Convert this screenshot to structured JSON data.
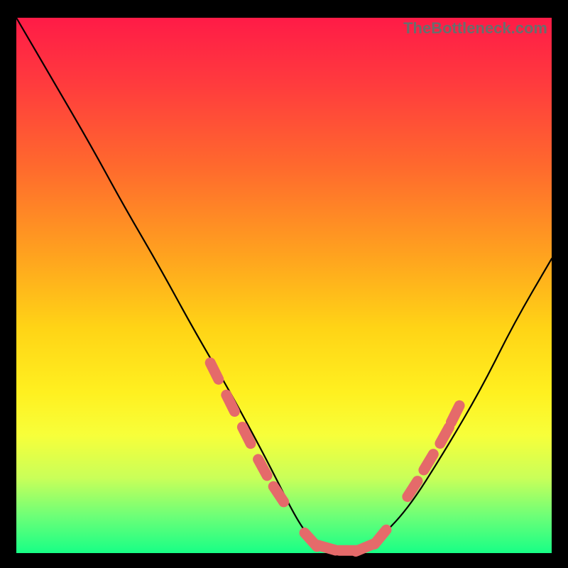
{
  "watermark": "TheBottleneck.com",
  "chart_data": {
    "type": "line",
    "title": "",
    "xlabel": "",
    "ylabel": "",
    "xlim": [
      0,
      100
    ],
    "ylim": [
      0,
      100
    ],
    "series": [
      {
        "name": "bottleneck-curve",
        "x": [
          0,
          7,
          14,
          20,
          27,
          33,
          40,
          47,
          53,
          56,
          60,
          64,
          67,
          73,
          80,
          87,
          93,
          100
        ],
        "values": [
          100,
          88,
          76,
          65,
          53,
          42,
          30,
          17,
          5,
          2,
          0,
          0,
          2,
          8,
          19,
          31,
          43,
          55
        ]
      }
    ],
    "markers": {
      "name": "highlighted-segments",
      "color": "#e56a6a",
      "points": [
        {
          "x": 37,
          "y": 34
        },
        {
          "x": 40,
          "y": 28
        },
        {
          "x": 43,
          "y": 22
        },
        {
          "x": 46,
          "y": 16
        },
        {
          "x": 49,
          "y": 11
        },
        {
          "x": 55,
          "y": 2.5
        },
        {
          "x": 58,
          "y": 1
        },
        {
          "x": 62,
          "y": 0.5
        },
        {
          "x": 65,
          "y": 1
        },
        {
          "x": 68,
          "y": 3
        },
        {
          "x": 74,
          "y": 12
        },
        {
          "x": 77,
          "y": 17
        },
        {
          "x": 80,
          "y": 22
        },
        {
          "x": 82,
          "y": 26
        }
      ]
    },
    "gradient_stops": [
      {
        "pos": 0,
        "color": "#ff1b47"
      },
      {
        "pos": 12,
        "color": "#ff3a3e"
      },
      {
        "pos": 28,
        "color": "#ff6a2d"
      },
      {
        "pos": 44,
        "color": "#ffa11f"
      },
      {
        "pos": 58,
        "color": "#ffd416"
      },
      {
        "pos": 70,
        "color": "#fff020"
      },
      {
        "pos": 78,
        "color": "#f7ff3a"
      },
      {
        "pos": 86,
        "color": "#c9ff59"
      },
      {
        "pos": 93,
        "color": "#6eff77"
      },
      {
        "pos": 100,
        "color": "#18ff86"
      }
    ]
  }
}
